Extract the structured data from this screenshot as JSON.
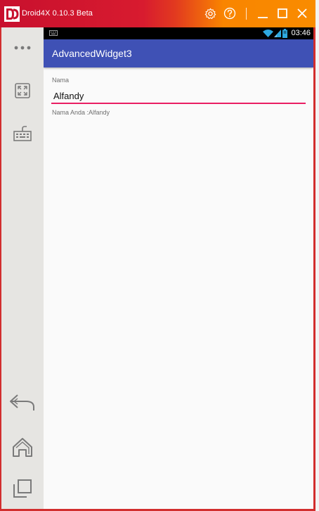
{
  "window": {
    "title": "Droid4X 0.10.3 Beta",
    "accent_colors": {
      "titlebar_start": "#c8102e",
      "titlebar_end": "#f98c00",
      "border": "#d22e2e"
    }
  },
  "titlebar": {
    "icons": [
      "settings-icon",
      "help-icon",
      "minimize-icon",
      "maximize-icon",
      "close-icon"
    ]
  },
  "sidebar": {
    "items": [
      {
        "name": "more-icon"
      },
      {
        "name": "fullscreen-icon"
      },
      {
        "name": "keyboard-icon"
      },
      {
        "name": "back-icon"
      },
      {
        "name": "home-icon"
      },
      {
        "name": "recent-apps-icon"
      }
    ],
    "background": "#e6e5e2"
  },
  "android": {
    "status_bar": {
      "time": "03:46",
      "icons": [
        "keyboard-indicator-icon",
        "wifi-icon",
        "signal-icon",
        "battery-icon"
      ]
    },
    "app_bar": {
      "title": "AdvancedWidget3",
      "color": "#3f51b5"
    },
    "form": {
      "field_label": "Nama",
      "input_value": "Alfandy",
      "underline_color": "#e91e63",
      "output_text": "Nama Anda :Alfandy"
    }
  }
}
